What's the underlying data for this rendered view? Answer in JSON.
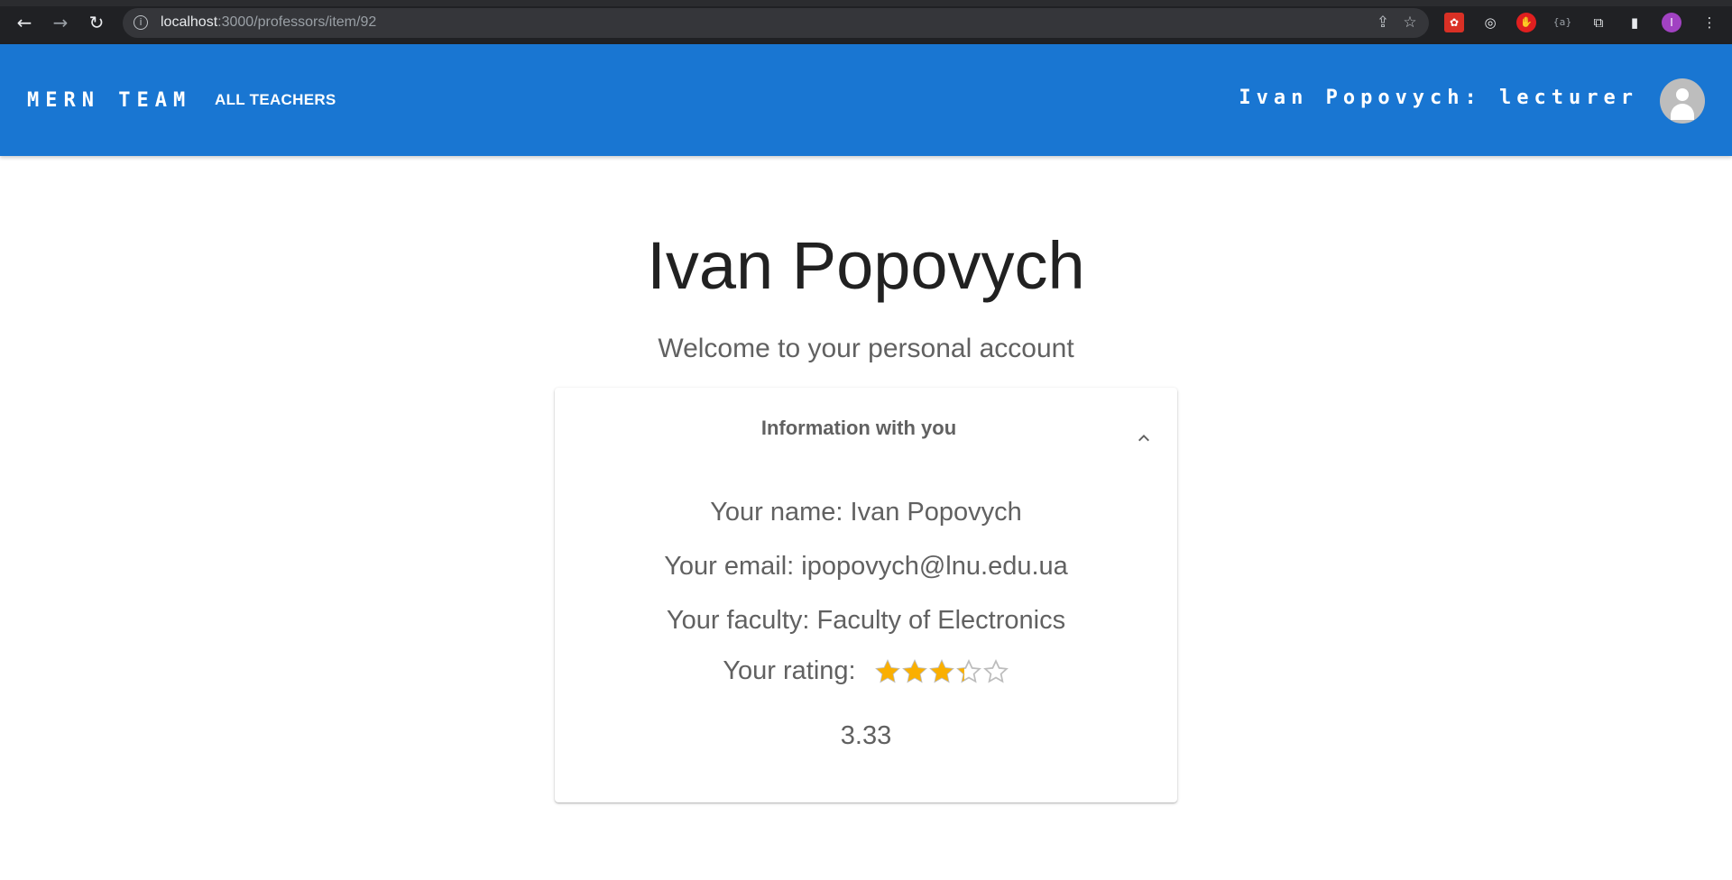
{
  "browser": {
    "url_host": "localhost",
    "url_path": ":3000/professors/item/92",
    "profile_initial": "I",
    "icons": [
      "back-arrow-icon",
      "forward-arrow-icon",
      "reload-icon",
      "site-info-icon",
      "share-icon",
      "bookmark-star-icon",
      "extension-icon",
      "puzzle-icon",
      "side-panel-icon",
      "more-menu-icon"
    ]
  },
  "appbar": {
    "brand": "MERN TEAM",
    "nav_all_teachers": "ALL TEACHERS",
    "user_label": "Ivan Popovych: lecturer",
    "color": "#1976d2"
  },
  "main": {
    "title": "Ivan Popovych",
    "subtitle": "Welcome to your personal account"
  },
  "card": {
    "header": "Information with you",
    "expanded": true,
    "name_line": "Your name: Ivan Popovych",
    "email_line": "Your email: ipopovych@lnu.edu.ua",
    "faculty_line": "Your faculty: Faculty of Electronics",
    "rating_label": "Your rating:",
    "rating_stars": 3.33,
    "rating_max": 5,
    "rating_value": "3.33",
    "star_color": "#faaf00"
  }
}
